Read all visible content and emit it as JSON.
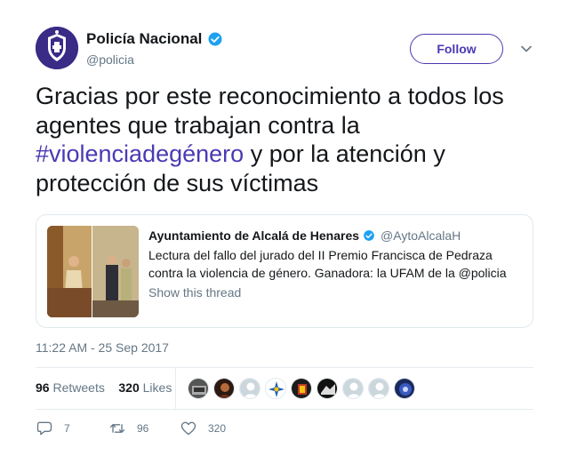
{
  "author": {
    "display_name": "Policía Nacional",
    "handle": "@policia",
    "avatar_icon": "police-shield-icon",
    "verified_icon": "verified-badge-icon",
    "follow_label": "Follow"
  },
  "tweet": {
    "text_before": "Gracias por este reconocimiento a todos los agentes que trabajan contra la ",
    "hashtag": "#violenciadegénero",
    "text_after": " y por la atención y protección de sus víctimas",
    "timestamp": "11:22 AM - 25 Sep 2017"
  },
  "quote": {
    "name": "Ayuntamiento de Alcalá de Henares",
    "handle": "@AytoAlcalaH",
    "text": "Lectura del fallo del jurado del II Premio Francisca de Pedraza contra la violencia de género. Ganadora: la UFAM de la @policia",
    "show_thread": "Show this thread"
  },
  "stats": {
    "retweets_count": "96",
    "retweets_label": "Retweets",
    "likes_count": "320",
    "likes_label": "Likes"
  },
  "actions": {
    "reply_count": "7",
    "retweet_count": "96",
    "like_count": "320"
  },
  "colors": {
    "accent": "#4a3ab3",
    "verified": "#1da1f2",
    "muted": "#657786"
  }
}
